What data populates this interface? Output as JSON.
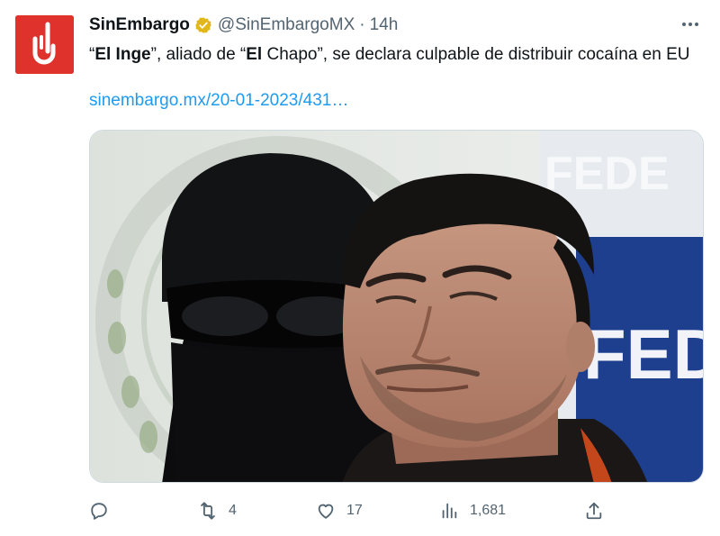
{
  "tweet": {
    "display_name": "SinEmbargo",
    "handle": "@SinEmbargoMX",
    "separator": "·",
    "time": "14h",
    "text": {
      "q1": "“",
      "b1": "El Inge",
      "t1": "”, aliado de “",
      "b2": "El",
      "t2": " Chapo”, se declara culpable de distribuir cocaína en EU"
    },
    "link": "sinembargo.mx/20-01-2023/431…"
  },
  "media": {
    "sign_text": "FEDE"
  },
  "actions": {
    "reply_count": "",
    "retweet_count": "4",
    "like_count": "17",
    "views_count": "1,681"
  },
  "icons": {
    "more": "more-icon",
    "verified": "verified-badge-icon",
    "reply": "reply-icon",
    "retweet": "retweet-icon",
    "like": "heart-icon",
    "views": "views-icon",
    "share": "share-icon"
  },
  "colors": {
    "brand_red": "#e0322d",
    "verified_gold": "#e2b719",
    "link_blue": "#1d9bf0",
    "muted": "#536471"
  }
}
